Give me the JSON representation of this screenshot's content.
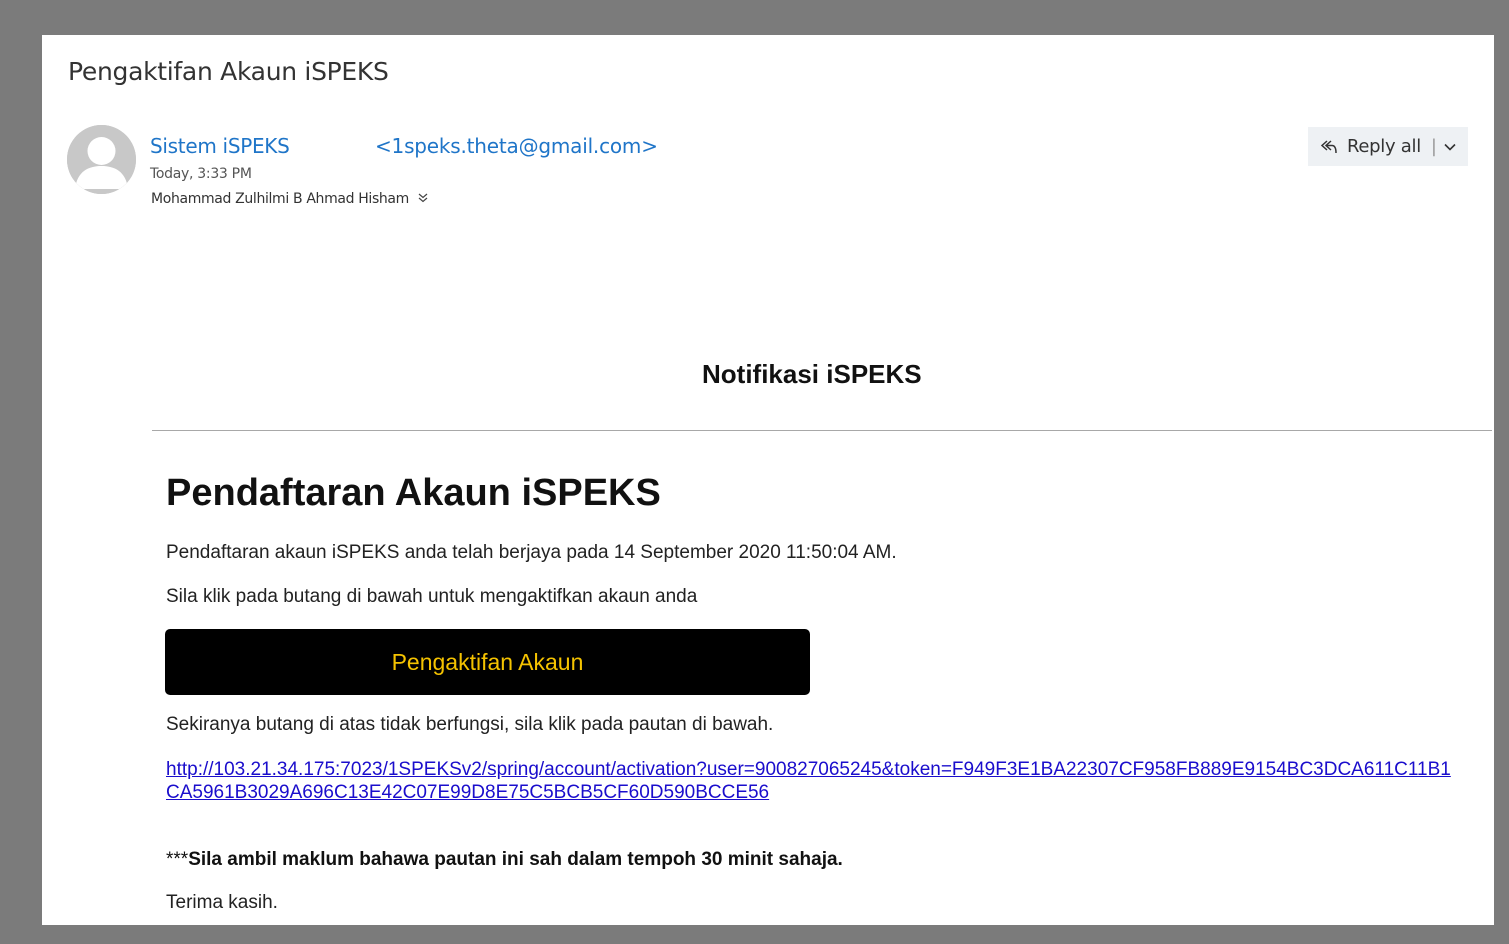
{
  "email": {
    "subject": "Pengaktifan Akaun iSPEKS",
    "sender_name": "Sistem iSPEKS",
    "sender_email": "<1speks.theta@gmail.com>",
    "timestamp": "Today, 3:33 PM",
    "recipient": "Mohammad Zulhilmi B Ahmad Hisham",
    "reply_all_label": "Reply all",
    "reply_sep": "|"
  },
  "body": {
    "notification_title": "Notifikasi iSPEKS",
    "heading": "Pendaftaran Akaun iSPEKS",
    "registration_text": "Pendaftaran akaun iSPEKS anda telah berjaya pada 14 September 2020 11:50:04 AM.",
    "instruction_text": "Sila klik pada butang di bawah untuk mengaktifkan akaun anda",
    "activate_button_label": "Pengaktifan Akaun",
    "fallback_text": "Sekiranya butang di atas tidak berfungsi, sila klik pada pautan di bawah.",
    "activation_link": "http://103.21.34.175:7023/1SPEKSv2/spring/account/activation?user=900827065245&token=F949F3E1BA22307CF958FB889E9154BC3DCA611C11B1CA5961B3029A696C13E42C07E99D8E75C5BCB5CF60D590BCCE56",
    "notice_prefix": "***",
    "notice_text": "Sila ambil maklum bahawa pautan ini sah dalam tempoh 30 minit sahaja.",
    "thanks": "Terima kasih."
  },
  "colors": {
    "sender_link": "#1f75c8",
    "button_bg": "#000000",
    "button_text": "#f5c300",
    "link": "#1a0dcc"
  },
  "icons": {
    "avatar": "default-user-avatar",
    "reply_all": "reply-all-icon",
    "chevron": "chevron-down-icon",
    "expand": "expand-recipients-icon"
  }
}
